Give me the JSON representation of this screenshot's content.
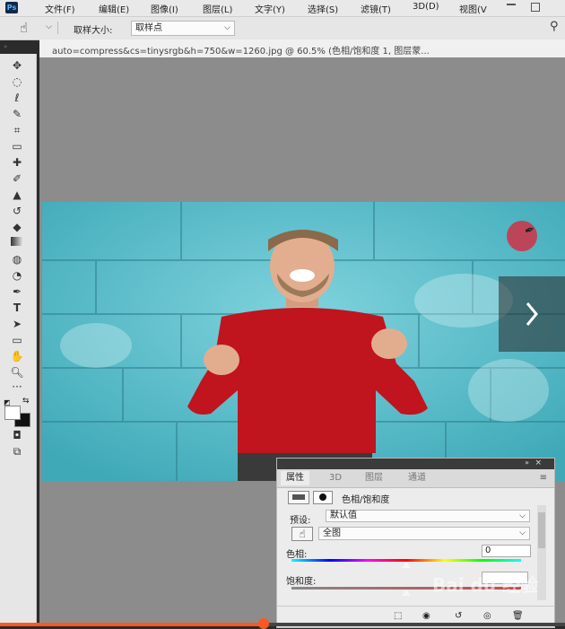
{
  "app": {
    "logo": "Ps"
  },
  "menu": [
    "文件(F)",
    "编辑(E)",
    "图像(I)",
    "图层(L)",
    "文字(Y)",
    "选择(S)",
    "滤镜(T)",
    "3D(D)",
    "视图(V"
  ],
  "options": {
    "tool_icon": "hand-sampler-icon",
    "sample_size_label": "取样大小:",
    "sample_size_value": "取样点"
  },
  "document": {
    "tab_title": "auto=compress&cs=tinysrgb&h=750&w=1260.jpg @ 60.5% (色相/饱和度 1, 图层蒙..."
  },
  "properties": {
    "tabs": [
      "属性",
      "3D",
      "图层",
      "通道"
    ],
    "active_tab": "属性",
    "title": "色相/饱和度",
    "preset_label": "预设:",
    "preset_value": "默认值",
    "channel_value": "全图",
    "hue_label": "色相:",
    "hue_value": "0",
    "saturation_label": "饱和度:",
    "hue_slider": 0.5,
    "saturation_slider": 0.5
  },
  "watermark": "Bai du 经验",
  "colors": {
    "accent": "#ff5722",
    "sweater": "#c0141f",
    "wall": "#5fc0cd"
  }
}
